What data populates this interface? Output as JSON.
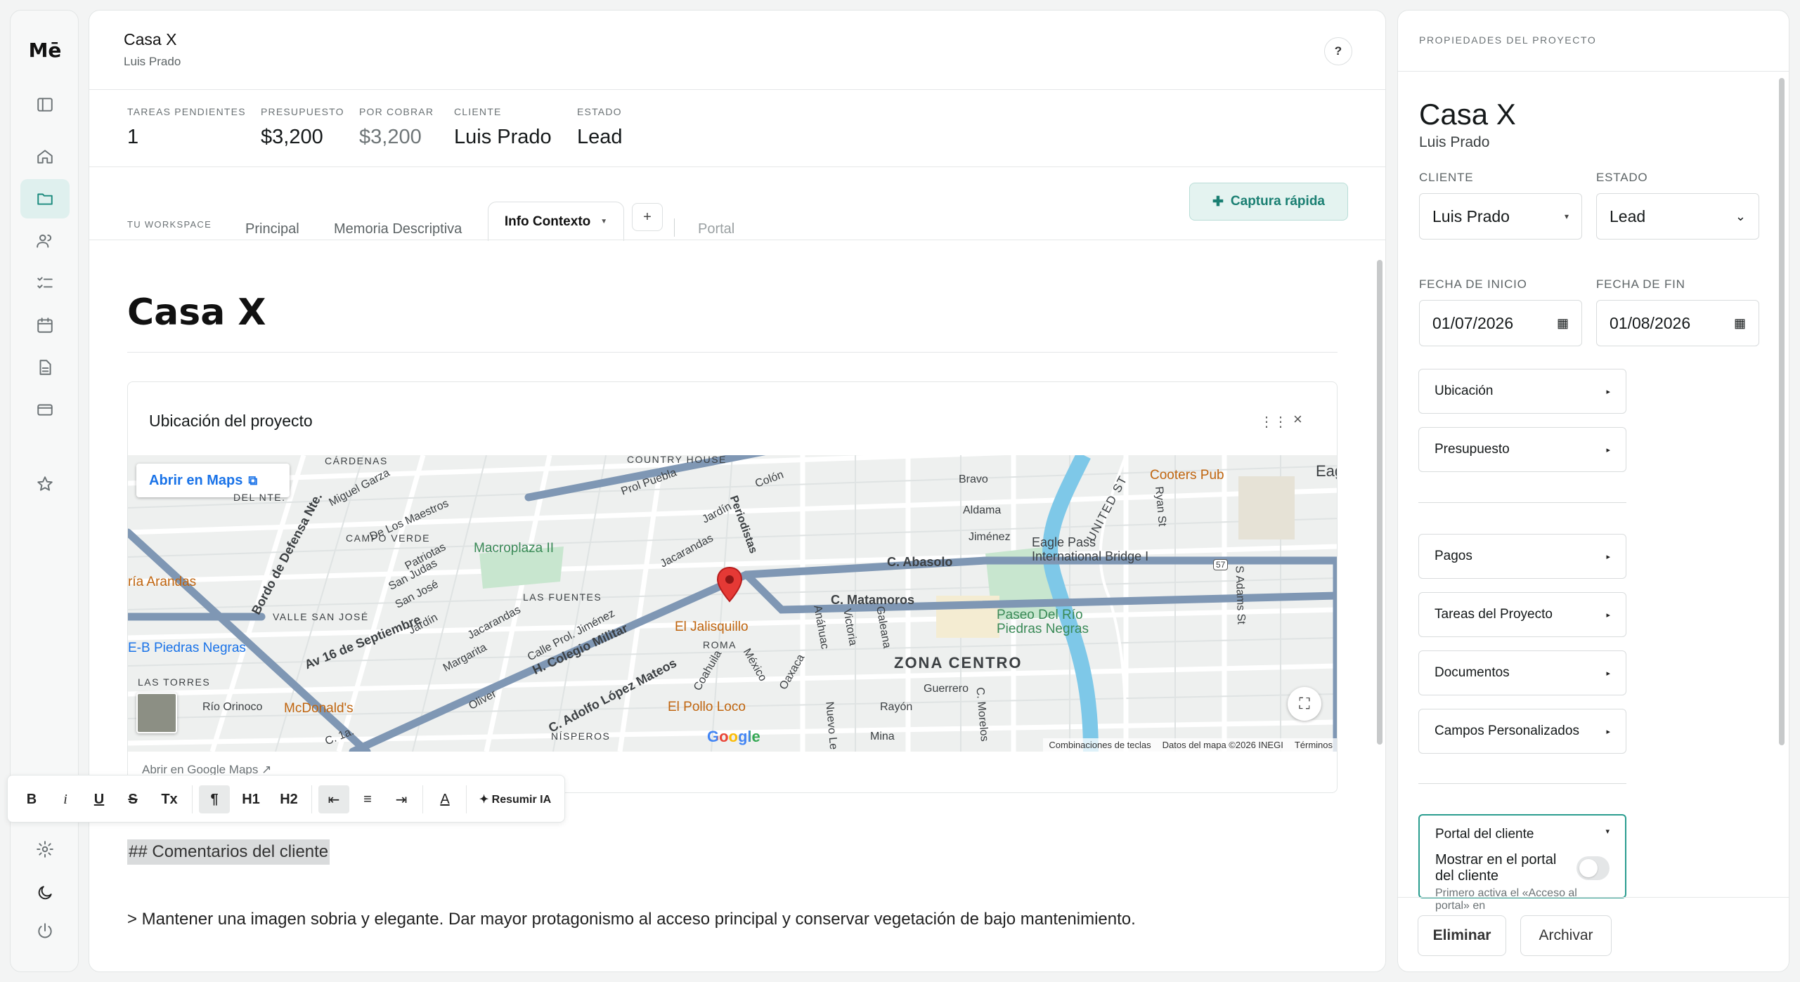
{
  "rail": {
    "logo": "Mē",
    "items": [
      {
        "name": "sidebar-toggle-icon"
      },
      {
        "name": "home-icon"
      },
      {
        "name": "folder-icon",
        "active": true
      },
      {
        "name": "users-icon"
      },
      {
        "name": "tasks-icon"
      },
      {
        "name": "calendar-icon"
      },
      {
        "name": "document-icon"
      },
      {
        "name": "card-icon"
      },
      {
        "name": "star-icon"
      }
    ],
    "bottom": [
      "settings-icon",
      "moon-icon",
      "power-icon"
    ]
  },
  "header": {
    "title": "Casa X",
    "subtitle": "Luis Prado",
    "help": "?"
  },
  "stats": [
    {
      "label": "TAREAS PENDIENTES",
      "value": "1"
    },
    {
      "label": "PRESUPUESTO",
      "value": "$3,200"
    },
    {
      "label": "POR COBRAR",
      "value": "$3,200"
    },
    {
      "label": "CLIENTE",
      "value": "Luis Prado"
    },
    {
      "label": "ESTADO",
      "value": "Lead"
    }
  ],
  "tabs": {
    "workspace_label": "TU WORKSPACE",
    "items": [
      "Principal",
      "Memoria Descriptiva",
      "Info Contexto",
      "Portal"
    ],
    "active": "Info Contexto",
    "add": "+",
    "capture": "Captura rápida"
  },
  "document": {
    "title": "Casa X",
    "map_card": {
      "title": "Ubicación del proyecto",
      "open_maps": "Abrir en Maps",
      "footer_link": "Abrir en Google Maps ↗",
      "map_labels": {
        "cardenas": "CÁRDENAS",
        "del_norte": "DEL NTE.",
        "country_house": "COUNTRY HOUSE",
        "campo_verde": "CAMPO VERDE",
        "valle": "VALLE SAN JOSÉ",
        "las_fuentes": "LAS FUENTES",
        "roma": "ROMA",
        "zona_centro": "ZONA CENTRO",
        "las_torres": "LAS TORRES",
        "nisperos": "NÍSPEROS",
        "macroplaza": "Macroplaza II",
        "paseo": "Paseo Del Río\nPiedras Negras",
        "bridge": "Eagle Pass\nInternational Bridge I",
        "cooters": "Cooters Pub",
        "jalisquillo": "El Jalisquillo",
        "pollo": "El Pollo Loco",
        "mcdonalds": "McDonald's",
        "arandas": "ría Arandas",
        "heb": "E-B Piedras Negras",
        "eagle": "Eag",
        "united": "UNITED ST",
        "abasolo": "C. Abasolo",
        "matamoros": "C. Matamoros",
        "colegio": "H. Colegio Militar",
        "adolfo": "C. Adolfo López Mateos",
        "av16": "Av 16 de Septiembre",
        "bordo": "Bordo de Defensa Nte.",
        "miguel": "Miguel Garza",
        "maestros": "De Los Maestros",
        "patriotas": "Patriotas",
        "sanjudas": "San Judas",
        "sanjose": "San José",
        "jardin": "Jardín",
        "jacarandas": "Jacarandas",
        "margarita": "Margarita",
        "olivar": "Oliver",
        "prol": "Calle Prol. Jiménez",
        "coahuila": "Coahuila",
        "mexico": "México",
        "oaxaca": "Oaxaca",
        "anahuac": "Anáhuac",
        "victoria": "Victoria",
        "galeana": "Galeana",
        "guerrero": "Guerrero",
        "morelos": "C. Morelos",
        "rayon": "Rayón",
        "mina": "Mina",
        "nuevo": "Nuevo Le",
        "aldama": "Aldama",
        "jimenez": "Jiménez",
        "bravo": "Bravo",
        "colon": "Colón",
        "periodistas": "Periodistas",
        "jardin2": "Jardín",
        "jacarandas2": "Jacarandas",
        "prolpuebla": "Prol Puebla",
        "rioorinoco": "Río Orinoco",
        "ryan": "Ryan St",
        "sadams": "S Adams St",
        "c1a": "C. 1a.",
        "route": "57",
        "google": "Google"
      },
      "map_footer": [
        "Combinaciones de teclas",
        "Datos del mapa ©2026 INEGI",
        "Términos"
      ]
    },
    "comment_heading": "## Comentarios del cliente",
    "comment_text": "> Mantener una imagen sobria y elegante. Dar mayor protagonismo al acceso principal y conservar vegetación de bajo mantenimiento."
  },
  "toolbar": {
    "bold": "B",
    "italic": "i",
    "underline": "U",
    "strike": "S",
    "clear": "Tx",
    "paragraph": "¶",
    "h1": "H1",
    "h2": "H2",
    "outdent": "⇤",
    "align": "≡",
    "indent": "⇥",
    "color": "A",
    "ai": "✦ Resumir IA"
  },
  "side": {
    "header": "PROPIEDADES DEL PROYECTO",
    "title": "Casa X",
    "subtitle": "Luis Prado",
    "cliente_label": "CLIENTE",
    "cliente_value": "Luis Prado",
    "estado_label": "ESTADO",
    "estado_value": "Lead",
    "inicio_label": "FECHA DE INICIO",
    "inicio_value": "01/07/2026",
    "fin_label": "FECHA DE FIN",
    "fin_value": "01/08/2026",
    "sections_a": [
      "Ubicación",
      "Presupuesto"
    ],
    "sections_b": [
      "Pagos",
      "Tareas del Proyecto",
      "Documentos",
      "Campos Personalizados"
    ],
    "portal_title": "Portal del cliente",
    "portal_toggle_label": "Mostrar en el portal del cliente",
    "portal_hint": "Primero activa el «Acceso al portal» en",
    "delete": "Eliminar",
    "archive": "Archivar"
  },
  "colors": {
    "accent": "#1a8a7d",
    "accent_bg": "#e4f3f0",
    "map_road": "#7f97b4",
    "map_water": "#7ec8e8",
    "map_pin": "#e53935"
  }
}
